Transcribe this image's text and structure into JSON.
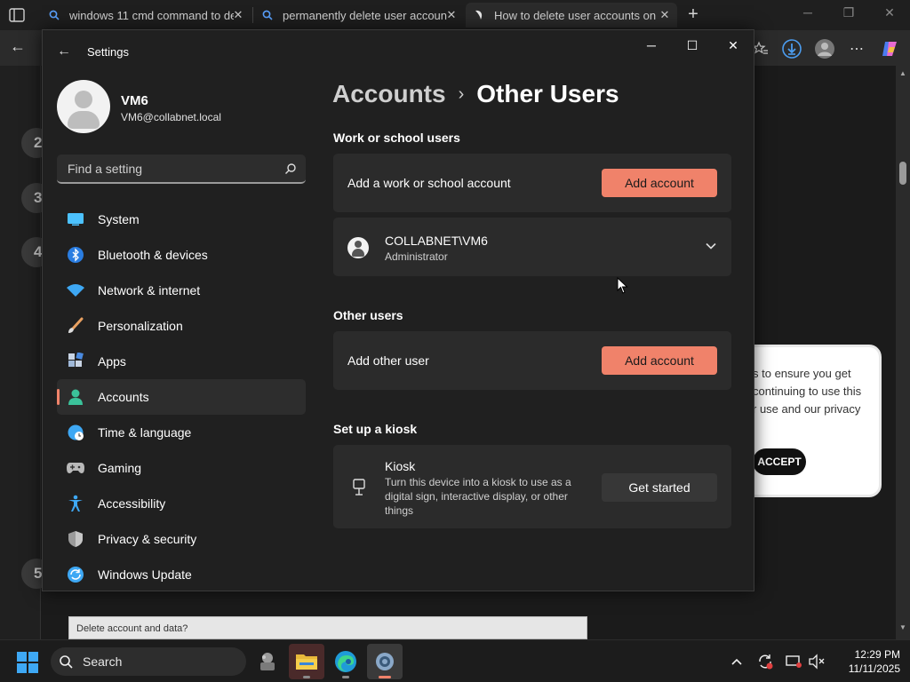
{
  "browser": {
    "tabs": [
      {
        "title": "windows 11 cmd command to de",
        "icon": "search-icon"
      },
      {
        "title": "permanently delete user account",
        "icon": "search-icon"
      },
      {
        "title": "How to delete user accounts on W",
        "icon": "site-logo-icon"
      }
    ],
    "new_tab": "+",
    "webpage": {
      "step_numbers": [
        "2",
        "3",
        "4",
        "5"
      ],
      "cookie_text": "s to ensure you get continuing to use this r use and our privacy",
      "cookie_accept": "ACCEPT",
      "button_text": "Delete account and data?"
    }
  },
  "settings": {
    "window_title": "Settings",
    "user": {
      "name": "VM6",
      "email": "VM6@collabnet.local"
    },
    "search": {
      "placeholder": "Find a setting"
    },
    "nav": [
      {
        "label": "System",
        "icon": "system-icon",
        "color": "#4cc2ff"
      },
      {
        "label": "Bluetooth & devices",
        "icon": "bluetooth-icon",
        "color": "#2a7de1"
      },
      {
        "label": "Network & internet",
        "icon": "wifi-icon",
        "color": "#3ea8f4"
      },
      {
        "label": "Personalization",
        "icon": "brush-icon",
        "color": "#e8a060"
      },
      {
        "label": "Apps",
        "icon": "apps-icon",
        "color": "#9fb8d8"
      },
      {
        "label": "Accounts",
        "icon": "accounts-icon",
        "color": "#3bc29a",
        "active": true
      },
      {
        "label": "Time & language",
        "icon": "globe-clock-icon",
        "color": "#3ea8f4"
      },
      {
        "label": "Gaming",
        "icon": "gamepad-icon",
        "color": "#b9b9b9"
      },
      {
        "label": "Accessibility",
        "icon": "accessibility-icon",
        "color": "#3ea8f4"
      },
      {
        "label": "Privacy & security",
        "icon": "shield-icon",
        "color": "#9a9a9a"
      },
      {
        "label": "Windows Update",
        "icon": "update-icon",
        "color": "#3ea8f4"
      }
    ],
    "breadcrumb": {
      "parent": "Accounts",
      "separator": "›",
      "current": "Other Users"
    },
    "work_school": {
      "heading": "Work or school users",
      "add_label": "Add a work or school account",
      "add_button": "Add account",
      "account": {
        "name": "COLLABNET\\VM6",
        "role": "Administrator"
      }
    },
    "other_users": {
      "heading": "Other users",
      "add_label": "Add other user",
      "add_button": "Add account"
    },
    "kiosk": {
      "heading": "Set up a kiosk",
      "title": "Kiosk",
      "description": "Turn this device into a kiosk to use as a digital sign, interactive display, or other things",
      "button": "Get started"
    },
    "accent_color": "#f0826a"
  },
  "taskbar": {
    "search_label": "Search",
    "time": "12:29 PM",
    "date": "11/11/2025"
  }
}
